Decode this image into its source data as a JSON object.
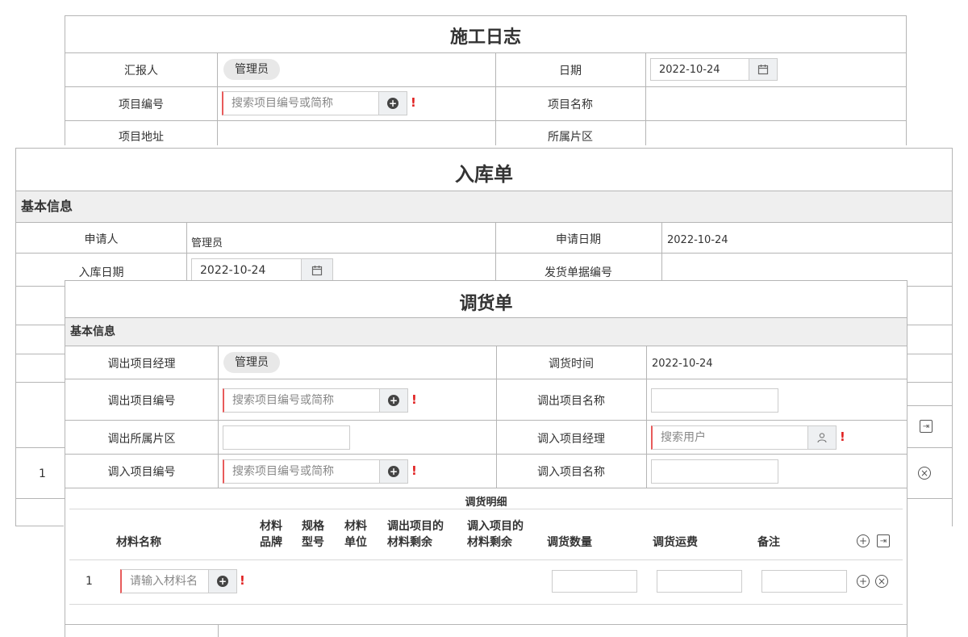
{
  "construction_log": {
    "title": "施工日志",
    "reporter_label": "汇报人",
    "reporter_value": "管理员",
    "date_label": "日期",
    "date_value": "2022-10-24",
    "project_no_label": "项目编号",
    "project_no_placeholder": "搜索项目编号或简称",
    "project_name_label": "项目名称",
    "project_address_label": "项目地址",
    "district_label": "所属片区"
  },
  "stock_in": {
    "title": "入库单",
    "section_basic": "基本信息",
    "applicant_label": "申请人",
    "applicant_value": "管理员",
    "apply_date_label": "申请日期",
    "apply_date_value": "2022-10-24",
    "stock_in_date_label": "入库日期",
    "stock_in_date_value": "2022-10-24",
    "delivery_no_label": "发货单据编号",
    "row_index": "1"
  },
  "transfer": {
    "title": "调货单",
    "section_basic": "基本信息",
    "out_manager_label": "调出项目经理",
    "out_manager_value": "管理员",
    "transfer_time_label": "调货时间",
    "transfer_time_value": "2022-10-24",
    "out_project_no_label": "调出项目编号",
    "out_project_no_placeholder": "搜索项目编号或简称",
    "out_project_name_label": "调出项目名称",
    "out_district_label": "调出所属片区",
    "in_manager_label": "调入项目经理",
    "in_manager_placeholder": "搜索用户",
    "in_project_no_label": "调入项目编号",
    "in_project_no_placeholder": "搜索项目编号或简称",
    "in_project_name_label": "调入项目名称",
    "detail_title": "调货明细",
    "columns": {
      "material_name": "材料名称",
      "brand_1": "材料",
      "brand_2": "品牌",
      "spec_1": "规格",
      "spec_2": "型号",
      "unit_1": "材料",
      "unit_2": "单位",
      "out_remain_1": "调出项目的",
      "out_remain_2": "材料剩余",
      "in_remain_1": "调入项目的",
      "in_remain_2": "材料剩余",
      "quantity": "调货数量",
      "freight": "调货运费",
      "remark": "备注"
    },
    "row_index": "1",
    "material_placeholder": "请输入材料名"
  },
  "required_mark": "!",
  "icons": {
    "add": "plus-circle-icon",
    "remove": "times-circle-icon",
    "calendar": "calendar-icon",
    "user": "user-icon",
    "import": "import-icon"
  },
  "colors": {
    "required": "#e02020",
    "section_bg": "#efefef",
    "border": "#b5b5b5"
  }
}
